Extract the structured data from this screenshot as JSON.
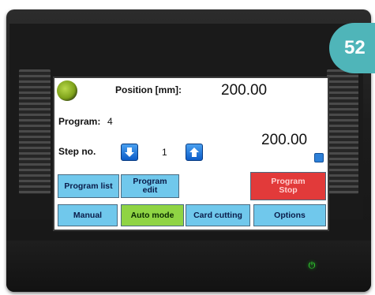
{
  "badge": "52",
  "screen": {
    "position_label": "Position [mm]:",
    "position_value": "200.00",
    "program_label": "Program:",
    "program_value": "4",
    "step_label": "Step no.",
    "step_value": "1",
    "target_value": "200.00",
    "icons": {
      "status": "status-indicator-led",
      "step_down": "arrow-down-icon",
      "step_up": "arrow-up-icon",
      "small": "small-blue-icon",
      "power": "power-icon"
    },
    "buttons_row1": {
      "program_list": "Program list",
      "program_edit_line1": "Program",
      "program_edit_line2": "edit",
      "program_stop_line1": "Program",
      "program_stop_line2": "Stop"
    },
    "buttons_row2": {
      "manual": "Manual",
      "auto_mode": "Auto mode",
      "card_cutting": "Card cutting",
      "options": "Options"
    }
  },
  "colors": {
    "badge": "#4fb5b9",
    "button_blue": "#70c8ec",
    "button_active_green": "#8fd444",
    "button_stop_red": "#e23a3a",
    "power_led": "#33dd33"
  }
}
